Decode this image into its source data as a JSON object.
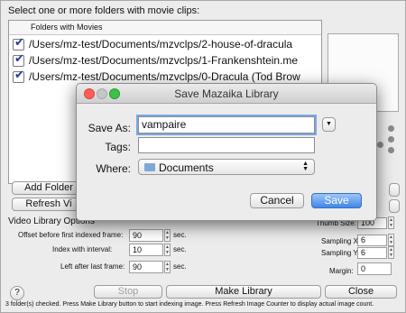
{
  "header": {
    "instruction": "Select one or more folders with movie clips:"
  },
  "folders": {
    "column_header": "Folders with Movies",
    "items": [
      {
        "checked": true,
        "path": "/Users/mz-test/Documents/mzvclps/2-house-of-dracula"
      },
      {
        "checked": true,
        "path": "/Users/mz-test/Documents/mzvclps/1-Frankenshtein.me"
      },
      {
        "checked": true,
        "path": "/Users/mz-test/Documents/mzvclps/0-Dracula (Tod Brow"
      }
    ]
  },
  "buttons": {
    "add_folder": "Add Folder",
    "refresh": "Refresh Vi",
    "stop": "Stop",
    "make_library": "Make Library",
    "close": "Close",
    "help": "?"
  },
  "options": {
    "section_title": "Video Library Options",
    "offset_label": "Offset before first indexed frame:",
    "offset_value": "90",
    "interval_label": "Index with interval:",
    "interval_value": "10",
    "left_after_label": "Left after last frame:",
    "left_after_value": "90",
    "unit": "sec."
  },
  "right_panel": {
    "thumb_size_label": "Thumb Size:",
    "thumb_size_value": "100",
    "sampling_x_label": "Sampling X:",
    "sampling_x_value": "6",
    "sampling_y_label": "Sampling Y:",
    "sampling_y_value": "6",
    "margin_label": "Margin:",
    "margin_value": "0"
  },
  "status": {
    "text": "3 folder(s) checked. Press Make Library button to start indexing image. Press Refresh Image Counter to display actual image count."
  },
  "dialog": {
    "title": "Save Mazaika Library",
    "save_as_label": "Save As:",
    "save_as_value": "vampaire",
    "tags_label": "Tags:",
    "tags_value": "",
    "where_label": "Where:",
    "where_value": "Documents",
    "cancel": "Cancel",
    "save": "Save",
    "colors": {
      "close": "#ff5f57",
      "minimize": "#c6c6c6",
      "zoom": "#3fc04a",
      "accent": "#3f87ea"
    }
  }
}
